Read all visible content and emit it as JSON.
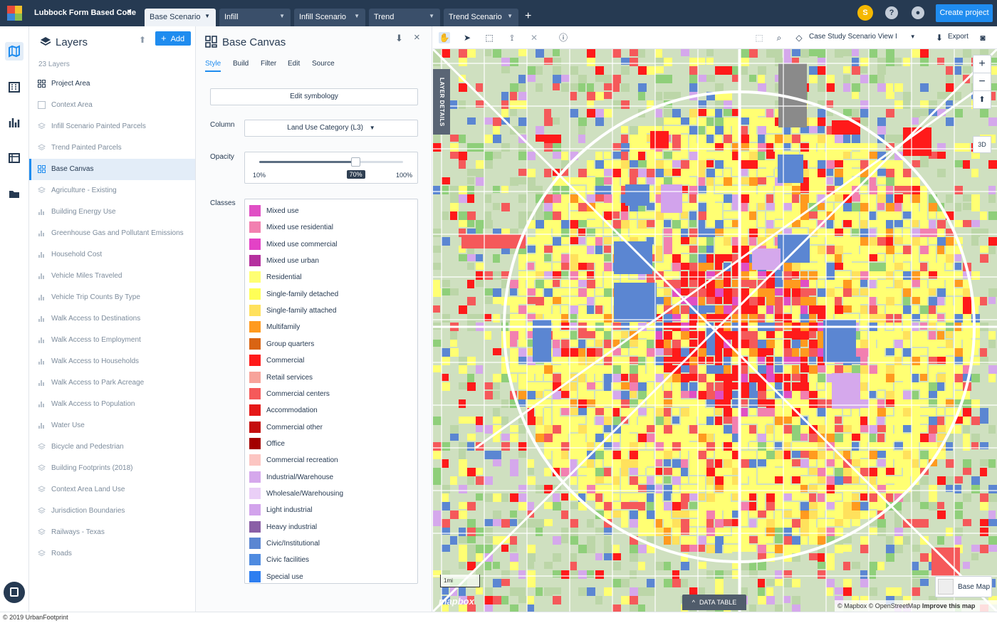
{
  "project": {
    "name": "Lubbock Form Based Code"
  },
  "tabs": [
    {
      "label": "Base Scenario",
      "active": true
    },
    {
      "label": "Infill",
      "active": false
    },
    {
      "label": "Infill Scenario",
      "active": false
    },
    {
      "label": "Trend",
      "active": false
    },
    {
      "label": "Trend Scenario",
      "active": false
    }
  ],
  "user": {
    "initial": "S"
  },
  "header": {
    "create_label": "Create project",
    "help_icon": "help-icon",
    "account_icon": "account-icon"
  },
  "sidebar_icons": [
    "map-icon",
    "building-icon",
    "chart-icon",
    "calendar-icon",
    "folder-icon"
  ],
  "layers_panel": {
    "title": "Layers",
    "add_label": "Add",
    "count": "23 Layers",
    "items": [
      {
        "label": "Project Area",
        "icon": "grid-icon",
        "state": "dark"
      },
      {
        "label": "Context Area",
        "icon": "square-icon",
        "state": "normal"
      },
      {
        "label": "Infill Scenario Painted Parcels",
        "icon": "layers-icon",
        "state": "normal"
      },
      {
        "label": "Trend Painted Parcels",
        "icon": "layers-icon",
        "state": "normal"
      },
      {
        "label": "Base Canvas",
        "icon": "grid-icon",
        "state": "active"
      },
      {
        "label": "Agriculture - Existing",
        "icon": "layers-icon",
        "state": "normal"
      },
      {
        "label": "Building Energy Use",
        "icon": "chart-icon",
        "state": "normal"
      },
      {
        "label": "Greenhouse Gas and Pollutant Emissions",
        "icon": "chart-icon",
        "state": "normal"
      },
      {
        "label": "Household Cost",
        "icon": "chart-icon",
        "state": "normal"
      },
      {
        "label": "Vehicle Miles Traveled",
        "icon": "chart-icon",
        "state": "normal"
      },
      {
        "label": "Vehicle Trip Counts By Type",
        "icon": "chart-icon",
        "state": "normal"
      },
      {
        "label": "Walk Access to Destinations",
        "icon": "chart-icon",
        "state": "normal"
      },
      {
        "label": "Walk Access to Employment",
        "icon": "chart-icon",
        "state": "normal"
      },
      {
        "label": "Walk Access to Households",
        "icon": "chart-icon",
        "state": "normal"
      },
      {
        "label": "Walk Access to Park Acreage",
        "icon": "chart-icon",
        "state": "normal"
      },
      {
        "label": "Walk Access to Population",
        "icon": "chart-icon",
        "state": "normal"
      },
      {
        "label": "Water Use",
        "icon": "chart-icon",
        "state": "normal"
      },
      {
        "label": "Bicycle and Pedestrian",
        "icon": "layers-icon",
        "state": "normal"
      },
      {
        "label": "Building Footprints (2018)",
        "icon": "layers-icon",
        "state": "normal"
      },
      {
        "label": "Context Area Land Use",
        "icon": "layers-icon",
        "state": "normal"
      },
      {
        "label": "Jurisdiction Boundaries",
        "icon": "layers-icon",
        "state": "normal"
      },
      {
        "label": "Railways - Texas",
        "icon": "layers-icon",
        "state": "normal"
      },
      {
        "label": "Roads",
        "icon": "layers-icon",
        "state": "normal"
      }
    ]
  },
  "canvas_panel": {
    "title": "Base Canvas",
    "tabs": [
      "Style",
      "Build",
      "Filter",
      "Edit",
      "Source"
    ],
    "active_tab": "Style",
    "edit_symbology": "Edit symbology",
    "column_label": "Column",
    "column_value": "Land Use Category (L3)",
    "opacity_label": "Opacity",
    "opacity_min": "10%",
    "opacity_max": "100%",
    "opacity_value": "70%",
    "opacity_fraction": 0.7,
    "classes_label": "Classes",
    "classes": [
      {
        "label": "Mixed use",
        "color": "#e04fc4"
      },
      {
        "label": "Mixed use residential",
        "color": "#f280b0"
      },
      {
        "label": "Mixed use commercial",
        "color": "#e342c6"
      },
      {
        "label": "Mixed use urban",
        "color": "#b5309e"
      },
      {
        "label": "Residential",
        "color": "#ffff73"
      },
      {
        "label": "Single-family detached",
        "color": "#ffff57"
      },
      {
        "label": "Single-family attached",
        "color": "#ffe15c"
      },
      {
        "label": "Multifamily",
        "color": "#ff9a1f"
      },
      {
        "label": "Group quarters",
        "color": "#d96413"
      },
      {
        "label": "Commercial",
        "color": "#ff1a1a"
      },
      {
        "label": "Retail services",
        "color": "#f7a39b"
      },
      {
        "label": "Commercial centers",
        "color": "#f5595a"
      },
      {
        "label": "Accommodation",
        "color": "#e51717"
      },
      {
        "label": "Commercial other",
        "color": "#c40e0e"
      },
      {
        "label": "Office",
        "color": "#a30000"
      },
      {
        "label": "Commercial recreation",
        "color": "#fcc5c2"
      },
      {
        "label": "Industrial/Warehouse",
        "color": "#d5a8ec"
      },
      {
        "label": "Wholesale/Warehousing",
        "color": "#eacff7"
      },
      {
        "label": "Light industrial",
        "color": "#d2a3ec"
      },
      {
        "label": "Heavy industrial",
        "color": "#8a5fa6"
      },
      {
        "label": "Civic/Institutional",
        "color": "#5b86d2"
      },
      {
        "label": "Civic facilities",
        "color": "#4f8be0"
      },
      {
        "label": "Special use",
        "color": "#2d7ef0"
      }
    ]
  },
  "map": {
    "scenario_view": "Case Study Scenario View I",
    "export_label": "Export",
    "layer_details": "LAYER DETAILS",
    "btn_3d": "3D",
    "scale": "1mi",
    "data_table": "DATA TABLE",
    "basemap_label": "Base Map",
    "attribution": "© Mapbox © OpenStreetMap",
    "improve": "Improve this map",
    "mapbox_logo": "mapbox"
  },
  "footer": {
    "copyright": "© 2019 UrbanFootprint"
  }
}
